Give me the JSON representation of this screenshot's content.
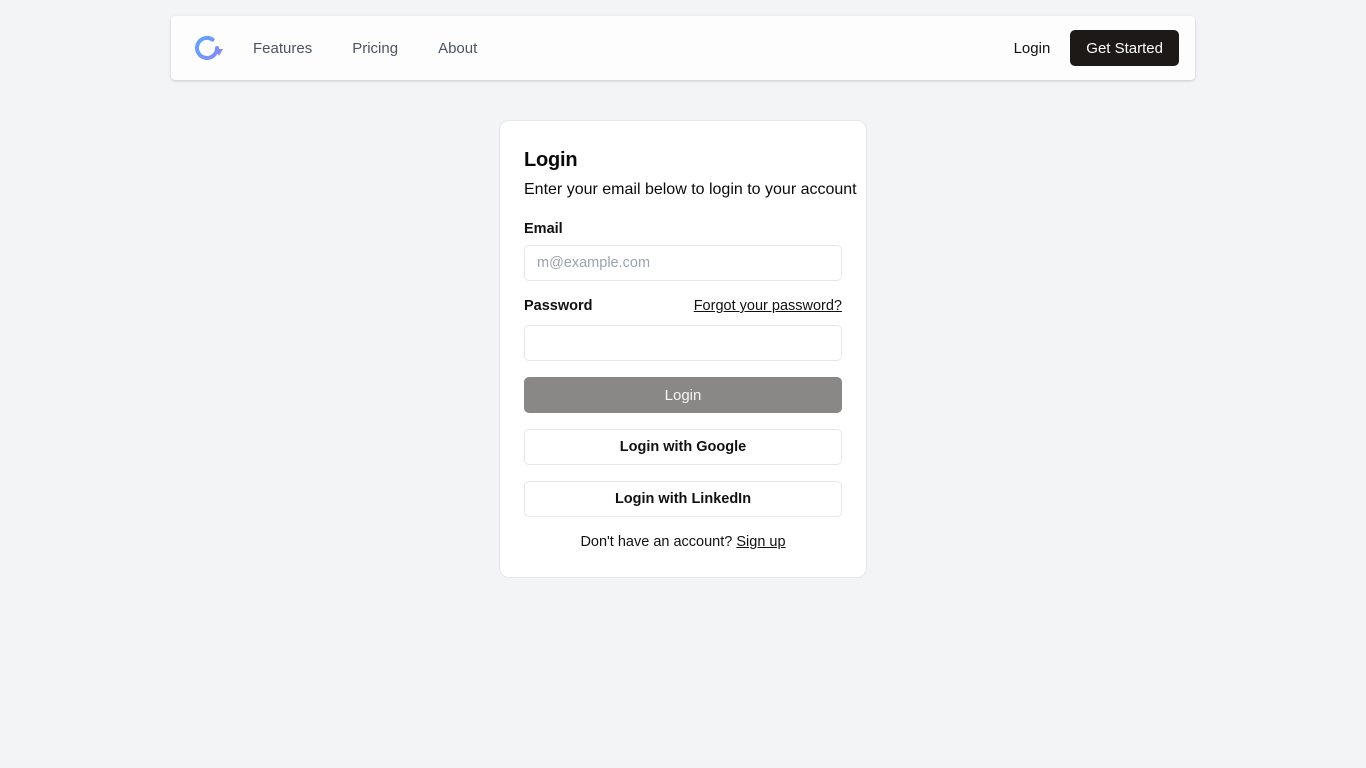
{
  "navbar": {
    "logo_icon": "refresh-arrow-logo",
    "links": [
      {
        "label": "Features"
      },
      {
        "label": "Pricing"
      },
      {
        "label": "About"
      }
    ],
    "login_label": "Login",
    "get_started_label": "Get Started"
  },
  "card": {
    "title": "Login",
    "subtitle": "Enter your email below to login to your account",
    "email": {
      "label": "Email",
      "placeholder": "m@example.com",
      "value": ""
    },
    "password": {
      "label": "Password",
      "forgot_label": "Forgot your password?",
      "value": ""
    },
    "login_button_label": "Login",
    "google_button_label": "Login with Google",
    "linkedin_button_label": "Login with LinkedIn",
    "signup_prompt": "Don't have an account?",
    "signup_link_label": "Sign up"
  },
  "colors": {
    "page_background": "#f3f4f6",
    "primary_dark": "#1c1917",
    "login_button_disabled": "#8a8886",
    "logo_gradient_start": "#60a5fa",
    "logo_gradient_end": "#818cf8"
  }
}
